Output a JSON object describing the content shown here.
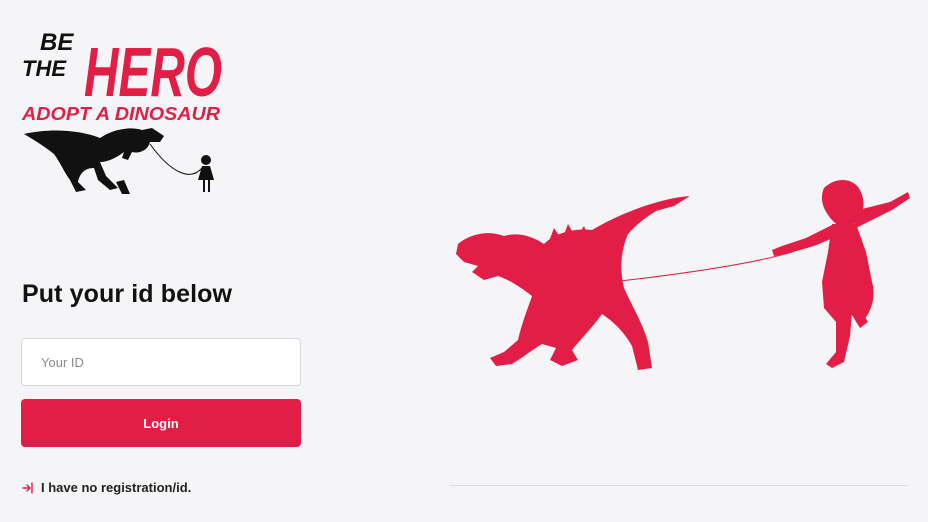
{
  "logo": {
    "line1": "BE",
    "line2": "THE",
    "word": "HERO",
    "tagline": "ADOPT A DINOSAUR"
  },
  "form": {
    "title": "Put your id below",
    "id_placeholder": "Your ID",
    "id_value": "",
    "login_label": "Login"
  },
  "links": {
    "no_registration": "I have no registration/id."
  },
  "colors": {
    "accent": "#e31e46",
    "text": "#111111",
    "background": "#f5f5f7"
  },
  "icons": {
    "no_registration": "sign-in-icon"
  }
}
